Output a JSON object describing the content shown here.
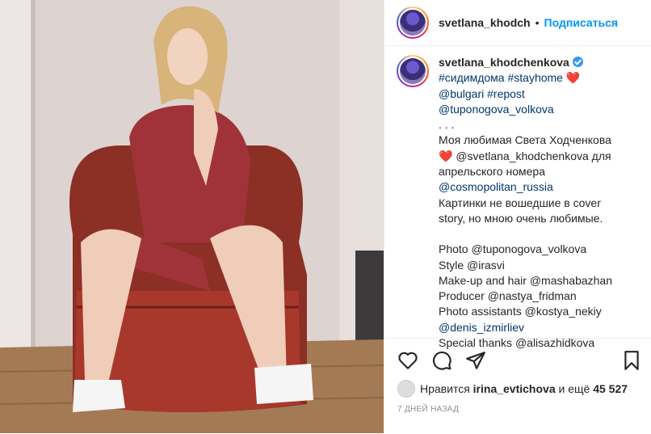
{
  "post": {
    "username": "svetlana_khodch",
    "follow_label": "Подписаться",
    "dot": "•"
  },
  "caption": {
    "author": "svetlana_khodchenkova",
    "lines": [
      "#сидимдома #stayhome",
      "@bulgari #repost",
      "@tuponogova_volkova",
      ". . .",
      "Моя любимая Света Ходченкова",
      "@svetlana_khodchenkova для",
      "апрельского номера",
      "@cosmopolitan_russia",
      "Картинки не вошедшие в cover",
      "story, но мною очень любимые.",
      "Photo @tuponogova_volkova",
      "Style @irasvi",
      "Make-up and hair @mashabazhan",
      "Producer @nastya_fridman",
      "Photo assistants @kostya_nekiy",
      "@denis_izmirliev",
      "Special thanks @alisazhidkova"
    ],
    "heart": "❤️"
  },
  "likes": {
    "prefix": "Нравится",
    "user": "irina_evtichova",
    "middle": "и ещё",
    "count": "45 527"
  },
  "time_label": "7 ДНЕЙ НАЗАД",
  "icons": [
    "heart-icon",
    "comment-icon",
    "share-icon",
    "bookmark-icon"
  ],
  "colors": {
    "accent": "#0095f6",
    "link": "#00376b",
    "muted": "#8e8e8e"
  }
}
